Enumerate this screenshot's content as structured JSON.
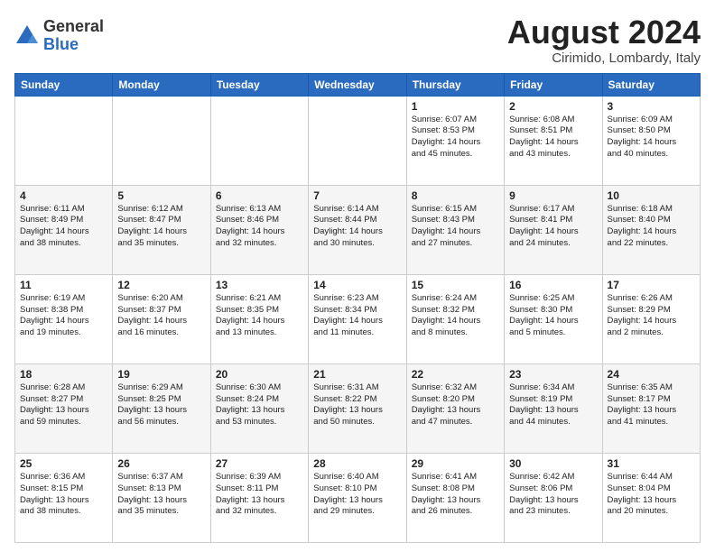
{
  "logo": {
    "general": "General",
    "blue": "Blue"
  },
  "title": "August 2024",
  "location": "Cirimido, Lombardy, Italy",
  "weekdays": [
    "Sunday",
    "Monday",
    "Tuesday",
    "Wednesday",
    "Thursday",
    "Friday",
    "Saturday"
  ],
  "weeks": [
    [
      {
        "day": "",
        "info": ""
      },
      {
        "day": "",
        "info": ""
      },
      {
        "day": "",
        "info": ""
      },
      {
        "day": "",
        "info": ""
      },
      {
        "day": "1",
        "info": "Sunrise: 6:07 AM\nSunset: 8:53 PM\nDaylight: 14 hours\nand 45 minutes."
      },
      {
        "day": "2",
        "info": "Sunrise: 6:08 AM\nSunset: 8:51 PM\nDaylight: 14 hours\nand 43 minutes."
      },
      {
        "day": "3",
        "info": "Sunrise: 6:09 AM\nSunset: 8:50 PM\nDaylight: 14 hours\nand 40 minutes."
      }
    ],
    [
      {
        "day": "4",
        "info": "Sunrise: 6:11 AM\nSunset: 8:49 PM\nDaylight: 14 hours\nand 38 minutes."
      },
      {
        "day": "5",
        "info": "Sunrise: 6:12 AM\nSunset: 8:47 PM\nDaylight: 14 hours\nand 35 minutes."
      },
      {
        "day": "6",
        "info": "Sunrise: 6:13 AM\nSunset: 8:46 PM\nDaylight: 14 hours\nand 32 minutes."
      },
      {
        "day": "7",
        "info": "Sunrise: 6:14 AM\nSunset: 8:44 PM\nDaylight: 14 hours\nand 30 minutes."
      },
      {
        "day": "8",
        "info": "Sunrise: 6:15 AM\nSunset: 8:43 PM\nDaylight: 14 hours\nand 27 minutes."
      },
      {
        "day": "9",
        "info": "Sunrise: 6:17 AM\nSunset: 8:41 PM\nDaylight: 14 hours\nand 24 minutes."
      },
      {
        "day": "10",
        "info": "Sunrise: 6:18 AM\nSunset: 8:40 PM\nDaylight: 14 hours\nand 22 minutes."
      }
    ],
    [
      {
        "day": "11",
        "info": "Sunrise: 6:19 AM\nSunset: 8:38 PM\nDaylight: 14 hours\nand 19 minutes."
      },
      {
        "day": "12",
        "info": "Sunrise: 6:20 AM\nSunset: 8:37 PM\nDaylight: 14 hours\nand 16 minutes."
      },
      {
        "day": "13",
        "info": "Sunrise: 6:21 AM\nSunset: 8:35 PM\nDaylight: 14 hours\nand 13 minutes."
      },
      {
        "day": "14",
        "info": "Sunrise: 6:23 AM\nSunset: 8:34 PM\nDaylight: 14 hours\nand 11 minutes."
      },
      {
        "day": "15",
        "info": "Sunrise: 6:24 AM\nSunset: 8:32 PM\nDaylight: 14 hours\nand 8 minutes."
      },
      {
        "day": "16",
        "info": "Sunrise: 6:25 AM\nSunset: 8:30 PM\nDaylight: 14 hours\nand 5 minutes."
      },
      {
        "day": "17",
        "info": "Sunrise: 6:26 AM\nSunset: 8:29 PM\nDaylight: 14 hours\nand 2 minutes."
      }
    ],
    [
      {
        "day": "18",
        "info": "Sunrise: 6:28 AM\nSunset: 8:27 PM\nDaylight: 13 hours\nand 59 minutes."
      },
      {
        "day": "19",
        "info": "Sunrise: 6:29 AM\nSunset: 8:25 PM\nDaylight: 13 hours\nand 56 minutes."
      },
      {
        "day": "20",
        "info": "Sunrise: 6:30 AM\nSunset: 8:24 PM\nDaylight: 13 hours\nand 53 minutes."
      },
      {
        "day": "21",
        "info": "Sunrise: 6:31 AM\nSunset: 8:22 PM\nDaylight: 13 hours\nand 50 minutes."
      },
      {
        "day": "22",
        "info": "Sunrise: 6:32 AM\nSunset: 8:20 PM\nDaylight: 13 hours\nand 47 minutes."
      },
      {
        "day": "23",
        "info": "Sunrise: 6:34 AM\nSunset: 8:19 PM\nDaylight: 13 hours\nand 44 minutes."
      },
      {
        "day": "24",
        "info": "Sunrise: 6:35 AM\nSunset: 8:17 PM\nDaylight: 13 hours\nand 41 minutes."
      }
    ],
    [
      {
        "day": "25",
        "info": "Sunrise: 6:36 AM\nSunset: 8:15 PM\nDaylight: 13 hours\nand 38 minutes."
      },
      {
        "day": "26",
        "info": "Sunrise: 6:37 AM\nSunset: 8:13 PM\nDaylight: 13 hours\nand 35 minutes."
      },
      {
        "day": "27",
        "info": "Sunrise: 6:39 AM\nSunset: 8:11 PM\nDaylight: 13 hours\nand 32 minutes."
      },
      {
        "day": "28",
        "info": "Sunrise: 6:40 AM\nSunset: 8:10 PM\nDaylight: 13 hours\nand 29 minutes."
      },
      {
        "day": "29",
        "info": "Sunrise: 6:41 AM\nSunset: 8:08 PM\nDaylight: 13 hours\nand 26 minutes."
      },
      {
        "day": "30",
        "info": "Sunrise: 6:42 AM\nSunset: 8:06 PM\nDaylight: 13 hours\nand 23 minutes."
      },
      {
        "day": "31",
        "info": "Sunrise: 6:44 AM\nSunset: 8:04 PM\nDaylight: 13 hours\nand 20 minutes."
      }
    ]
  ]
}
